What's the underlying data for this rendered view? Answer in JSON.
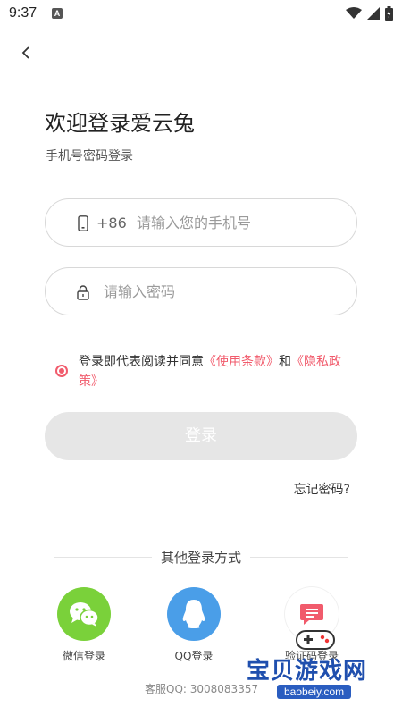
{
  "status_bar": {
    "time": "9:37",
    "notification_icon": "a-app-icon",
    "icons": [
      "wifi-icon",
      "signal-icon",
      "battery-icon"
    ]
  },
  "header": {
    "back_icon": "chevron-left-icon"
  },
  "login": {
    "title": "欢迎登录爱云兔",
    "subtitle": "手机号密码登录",
    "phone": {
      "icon": "phone-icon",
      "prefix": "+86",
      "placeholder": "请输入您的手机号",
      "value": ""
    },
    "password": {
      "icon": "lock-icon",
      "placeholder": "请输入密码",
      "value": ""
    },
    "agreement": {
      "checked": true,
      "text_before": "登录即代表阅读并同意",
      "terms_link": "《使用条款》",
      "and_text": "和",
      "privacy_link": "《隐私政策》"
    },
    "login_button": "登录",
    "forgot_password": "忘记密码?"
  },
  "other_login": {
    "heading": "其他登录方式",
    "options": [
      {
        "label": "微信登录",
        "icon": "wechat-icon",
        "color": "#7ad13a"
      },
      {
        "label": "QQ登录",
        "icon": "qq-icon",
        "color": "#4a9ee8"
      },
      {
        "label": "验证码登录",
        "icon": "sms-icon",
        "color": "#f15b6c"
      }
    ]
  },
  "footer": {
    "service": "客服QQ: 3008083357"
  },
  "watermark": {
    "text": "宝贝游戏网",
    "url": "baobeiy.com"
  },
  "colors": {
    "accent": "#f15b6c",
    "button_disabled": "#e6e6e6",
    "wechat": "#7ad13a",
    "qq": "#4a9ee8"
  }
}
